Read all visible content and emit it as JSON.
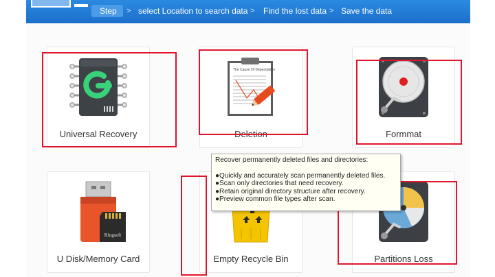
{
  "breadcrumb": {
    "steps": [
      "Step",
      "select Location to search data",
      "Find the lost data",
      "Save the data"
    ],
    "separator": ">"
  },
  "modes": [
    {
      "label": "Universal Recovery",
      "icon": "chip-g-icon"
    },
    {
      "label": "Deletion",
      "icon": "clipboard-pencil-icon"
    },
    {
      "label": "Formmat",
      "icon": "hard-drive-icon"
    },
    {
      "label": "U Disk/Memory Card",
      "icon": "usb-sd-card-icon",
      "card_text": "Kingsoft"
    },
    {
      "label": "Empty Recycle Bin",
      "icon": "recycle-bin-icon"
    },
    {
      "label": "Partitions Loss",
      "icon": "partition-disk-icon"
    }
  ],
  "doc_title": "The Cause Of Dependation",
  "tooltip": {
    "heading": "Recover permanently deleted files and directories:",
    "items": [
      "●Quickly and accurately scan permanently deleted files.",
      "●Scan only directories that need recovery.",
      "●Retain original directory structure after recovery.",
      "●Preview common file types after scan."
    ]
  },
  "colors": {
    "header": "#1c6fcc",
    "highlight": "#e2142b",
    "tooltip_bg": "#fffff4"
  }
}
